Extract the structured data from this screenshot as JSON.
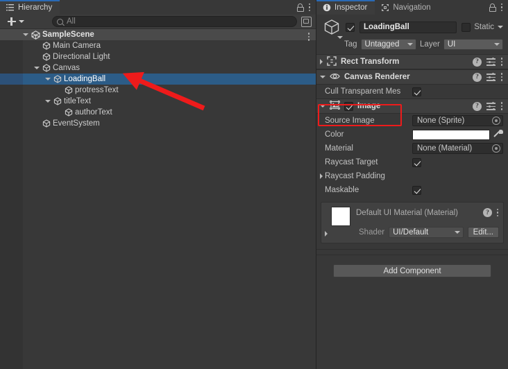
{
  "hierarchy": {
    "tab": {
      "label": "Hierarchy",
      "icon": "hierarchy-list-icon"
    },
    "lock_icon": "lock-icon",
    "menu_icon": "kebab-menu-icon",
    "toolbar": {
      "create_label": "+",
      "create_icon": "plus-icon",
      "create_caret_icon": "chevron-down-icon",
      "search_placeholder": "All",
      "search_value": "",
      "search_icon": "search-icon",
      "popout_icon": "popout-window-icon"
    },
    "tree": [
      {
        "label": "SampleScene",
        "depth": 0,
        "twisty": "down",
        "icon": "scene-icon",
        "selected": false,
        "is_scene": true,
        "menu": true
      },
      {
        "label": "Main Camera",
        "depth": 1,
        "twisty": "none",
        "icon": "gameobject-icon",
        "selected": false,
        "is_scene": false,
        "menu": false
      },
      {
        "label": "Directional Light",
        "depth": 1,
        "twisty": "none",
        "icon": "gameobject-icon",
        "selected": false,
        "is_scene": false,
        "menu": false
      },
      {
        "label": "Canvas",
        "depth": 1,
        "twisty": "down",
        "icon": "gameobject-icon",
        "selected": false,
        "is_scene": false,
        "menu": false
      },
      {
        "label": "LoadingBall",
        "depth": 2,
        "twisty": "down",
        "icon": "gameobject-icon",
        "selected": true,
        "is_scene": false,
        "menu": false
      },
      {
        "label": "protressText",
        "depth": 3,
        "twisty": "none",
        "icon": "gameobject-icon",
        "selected": false,
        "is_scene": false,
        "menu": false
      },
      {
        "label": "titleText",
        "depth": 2,
        "twisty": "down",
        "icon": "gameobject-icon",
        "selected": false,
        "is_scene": false,
        "menu": false
      },
      {
        "label": "authorText",
        "depth": 3,
        "twisty": "none",
        "icon": "gameobject-icon",
        "selected": false,
        "is_scene": false,
        "menu": false
      },
      {
        "label": "EventSystem",
        "depth": 1,
        "twisty": "none",
        "icon": "gameobject-icon",
        "selected": false,
        "is_scene": false,
        "menu": false
      }
    ]
  },
  "inspector": {
    "tabs": [
      {
        "label": "Inspector",
        "icon": "info-circle-icon",
        "active": true
      },
      {
        "label": "Navigation",
        "icon": "navigation-icon",
        "active": false
      }
    ],
    "lock_icon": "lock-icon",
    "menu_icon": "kebab-menu-icon",
    "object": {
      "icon": "gameobject-icon",
      "enabled": true,
      "name": "LoadingBall",
      "static_label": "Static",
      "static_checked": false,
      "tag_label": "Tag",
      "tag_value": "Untagged",
      "layer_label": "Layer",
      "layer_value": "UI"
    },
    "components": [
      {
        "name": "Rect Transform",
        "icon": "rect-transform-icon",
        "expanded": false,
        "has_toggle": false,
        "enabled": false
      },
      {
        "name": "Canvas Renderer",
        "icon": "eye-icon",
        "expanded": true,
        "has_toggle": false,
        "enabled": false
      },
      {
        "name": "Image",
        "icon": "image-icon",
        "expanded": true,
        "has_toggle": true,
        "enabled": true
      }
    ],
    "canvas_renderer_props": [
      {
        "label": "Cull Transparent Mes",
        "type": "checkbox",
        "value": true
      }
    ],
    "image_props": [
      {
        "label": "Source Image",
        "type": "object",
        "value": "None (Sprite)"
      },
      {
        "label": "Color",
        "type": "color",
        "value": "#FFFFFF"
      },
      {
        "label": "Material",
        "type": "object",
        "value": "None (Material)"
      },
      {
        "label": "Raycast Target",
        "type": "checkbox",
        "value": true
      },
      {
        "label": "Raycast Padding",
        "type": "foldout",
        "value": ""
      },
      {
        "label": "Maskable",
        "type": "checkbox",
        "value": true
      }
    ],
    "material_block": {
      "title": "Default UI Material (Material)",
      "shader_label": "Shader",
      "shader_value": "UI/Default",
      "edit_label": "Edit...",
      "swatch_color": "#FFFFFF",
      "help_icon": "help-circle-icon",
      "menu_icon": "kebab-menu-icon",
      "foldout_icon": "chevron-right-icon"
    },
    "add_component_label": "Add Component",
    "icons": {
      "help": "help-circle-icon",
      "preset": "preset-settings-icon",
      "menu": "kebab-menu-icon",
      "object_picker": "object-picker-icon",
      "eyedropper": "eyedropper-icon"
    }
  },
  "annotations": {
    "highlight_color": "#ee1b1b",
    "box_target": "Image",
    "arrow_target": "LoadingBall"
  }
}
